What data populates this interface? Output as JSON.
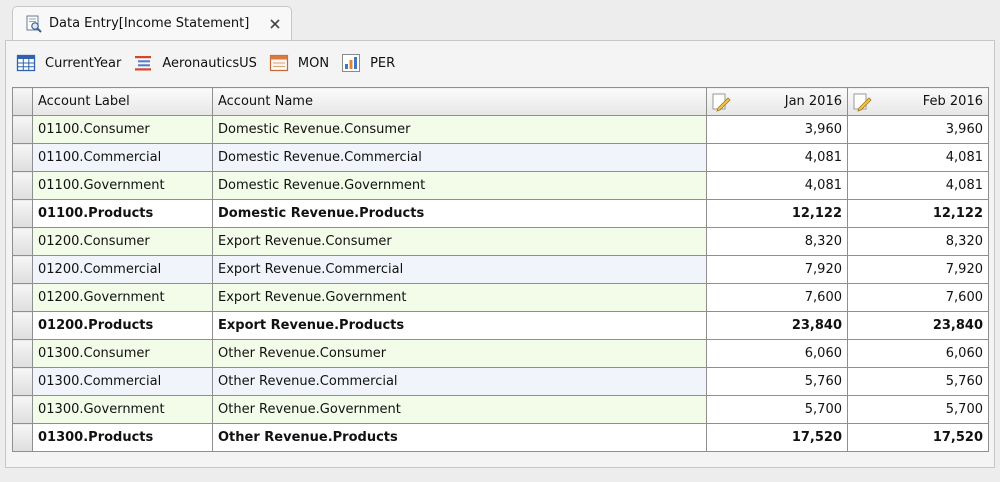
{
  "tab": {
    "label": "Data Entry[Income Statement]",
    "close_glyph": "✕"
  },
  "toolbar": {
    "items": [
      {
        "label": "CurrentYear",
        "icon": "calendar-grid-icon"
      },
      {
        "label": "AeronauticsUS",
        "icon": "list-icon"
      },
      {
        "label": "MON",
        "icon": "calendar-icon"
      },
      {
        "label": "PER",
        "icon": "bar-chart-icon"
      }
    ]
  },
  "grid": {
    "columns": [
      "Account Label",
      "Account Name",
      "Jan 2016",
      "Feb 2016"
    ],
    "rows": [
      {
        "label": "01100.Consumer",
        "name": "Domestic Revenue.Consumer",
        "jan": "3,960",
        "feb": "3,960",
        "total": false
      },
      {
        "label": "01100.Commercial",
        "name": "Domestic Revenue.Commercial",
        "jan": "4,081",
        "feb": "4,081",
        "total": false
      },
      {
        "label": "01100.Government",
        "name": "Domestic Revenue.Government",
        "jan": "4,081",
        "feb": "4,081",
        "total": false
      },
      {
        "label": "01100.Products",
        "name": "Domestic Revenue.Products",
        "jan": "12,122",
        "feb": "12,122",
        "total": true
      },
      {
        "label": "01200.Consumer",
        "name": "Export Revenue.Consumer",
        "jan": "8,320",
        "feb": "8,320",
        "total": false
      },
      {
        "label": "01200.Commercial",
        "name": "Export Revenue.Commercial",
        "jan": "7,920",
        "feb": "7,920",
        "total": false
      },
      {
        "label": "01200.Government",
        "name": "Export Revenue.Government",
        "jan": "7,600",
        "feb": "7,600",
        "total": false
      },
      {
        "label": "01200.Products",
        "name": "Export Revenue.Products",
        "jan": "23,840",
        "feb": "23,840",
        "total": true
      },
      {
        "label": "01300.Consumer",
        "name": "Other Revenue.Consumer",
        "jan": "6,060",
        "feb": "6,060",
        "total": false
      },
      {
        "label": "01300.Commercial",
        "name": "Other Revenue.Commercial",
        "jan": "5,760",
        "feb": "5,760",
        "total": false
      },
      {
        "label": "01300.Government",
        "name": "Other Revenue.Government",
        "jan": "5,700",
        "feb": "5,700",
        "total": false
      },
      {
        "label": "01300.Products",
        "name": "Other Revenue.Products",
        "jan": "17,520",
        "feb": "17,520",
        "total": true
      }
    ]
  },
  "colors": {
    "row_green": "#f3fbe9",
    "row_blue": "#f1f5fb",
    "grid_border": "#8f8f8f"
  }
}
